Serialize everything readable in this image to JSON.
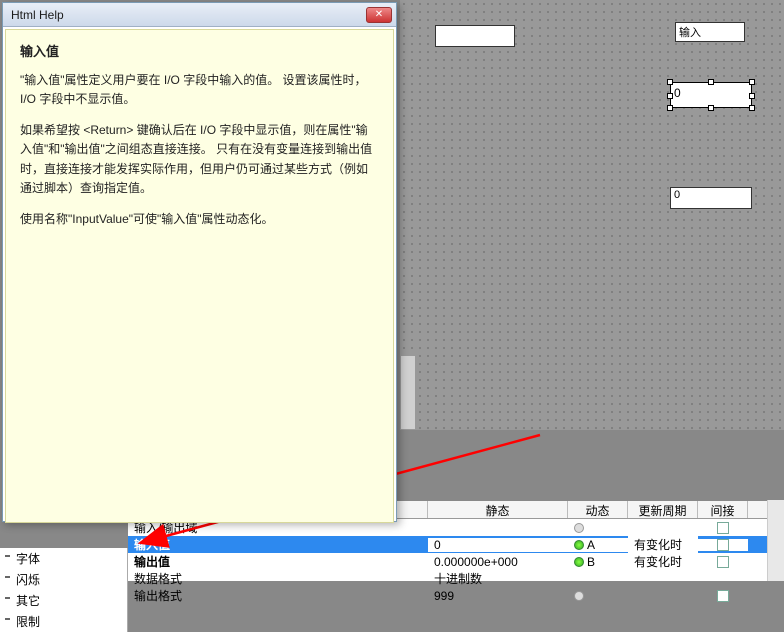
{
  "help": {
    "window_title": "Html Help",
    "heading": "输入值",
    "para1": "\"输入值\"属性定义用户要在 I/O 字段中输入的值。 设置该属性时，I/O 字段中不显示值。",
    "para2": "如果希望按 <Return> 键确认后在 I/O 字段中显示值，则在属性\"输入值\"和\"输出值\"之间组态直接连接。 只有在没有变量连接到输出值时，直接连接才能发挥实际作用，但用户仍可通过某些方式（例如通过脚本）查询指定值。",
    "para3": "使用名称\"InputValue\"可使\"输入值\"属性动态化。"
  },
  "canvas": {
    "field1_value": "",
    "field2_value": "输入",
    "field3_value": "0",
    "field4_value": "0"
  },
  "sidebar": {
    "items": [
      "字体",
      "闪烁",
      "其它",
      "限制"
    ]
  },
  "prop": {
    "headers": {
      "static": "静态",
      "dynamic": "动态",
      "update": "更新周期",
      "indirect": "间接"
    },
    "rows": [
      {
        "name": "输入/输出域",
        "static": "",
        "dynamic": "",
        "update": "",
        "checkbox": true,
        "bulb": "off"
      },
      {
        "name": "输入值",
        "static": "0",
        "dynamic": "A",
        "update": "有变化时",
        "checkbox": true,
        "bulb": "on",
        "selected": true
      },
      {
        "name": "输出值",
        "static": "0.000000e+000",
        "dynamic": "B",
        "update": "有变化时",
        "checkbox": true,
        "bulb": "on"
      },
      {
        "name": "数据格式",
        "static": "十进制数",
        "dynamic": "",
        "update": "",
        "checkbox": false
      },
      {
        "name": "输出格式",
        "static": "999",
        "dynamic": "",
        "update": "",
        "checkbox": true,
        "bulb": "off"
      }
    ]
  }
}
